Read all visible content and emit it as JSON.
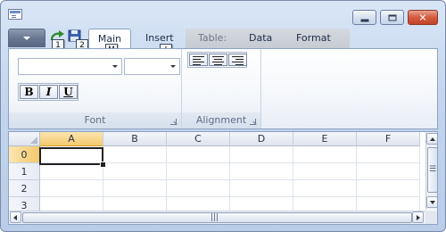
{
  "window": {
    "title": "",
    "close_glyph": "✕"
  },
  "quick_access": {
    "redo_key": "1",
    "save_key": "2"
  },
  "tabs": {
    "main": {
      "label": "Main",
      "key": "M"
    },
    "insert": {
      "label": "Insert",
      "key": "I"
    },
    "context_title": "Table:",
    "data": {
      "label": "Data"
    },
    "format": {
      "label": "Format"
    }
  },
  "groups": {
    "font": {
      "label": "Font",
      "font_name": "",
      "font_size": "",
      "bold": "B",
      "italic": "I",
      "underline": "U"
    },
    "alignment": {
      "label": "Alignment"
    }
  },
  "sheet": {
    "columns": [
      "A",
      "B",
      "C",
      "D",
      "E",
      "F"
    ],
    "rows": [
      "0",
      "1",
      "2",
      "3"
    ],
    "selected_column": "A",
    "selected_row": "0",
    "scroll_grip": "☰",
    "hscroll_grip": "|||"
  },
  "colors": {
    "accent": "#f4c96c",
    "window_border": "#7a8aa8",
    "close": "#c2432a"
  }
}
